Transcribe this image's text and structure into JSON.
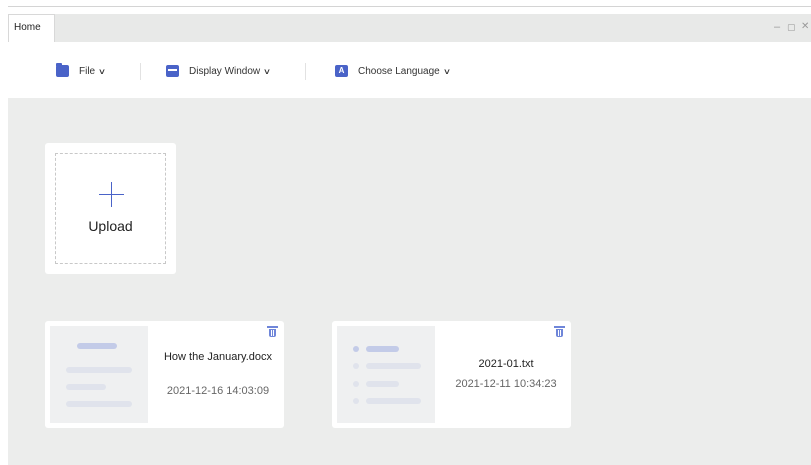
{
  "tabs": [
    {
      "label": "Home"
    }
  ],
  "window_controls": {
    "minimize": "–",
    "restore": "▢",
    "close": "✕"
  },
  "toolbar": {
    "file_label": "File",
    "display_label": "Display Window",
    "language_label": "Choose Language",
    "language_icon_letter": "A",
    "chevron": "∨"
  },
  "upload": {
    "label": "Upload"
  },
  "files": [
    {
      "name": "How the January.docx",
      "date": "2021-12-16 14:03:09"
    },
    {
      "name": "2021-01.txt",
      "date": "2021-12-11 10:34:23"
    }
  ],
  "colors": {
    "accent": "#4a63c8",
    "background": "#ecedec",
    "trash": "#6f86d9"
  }
}
